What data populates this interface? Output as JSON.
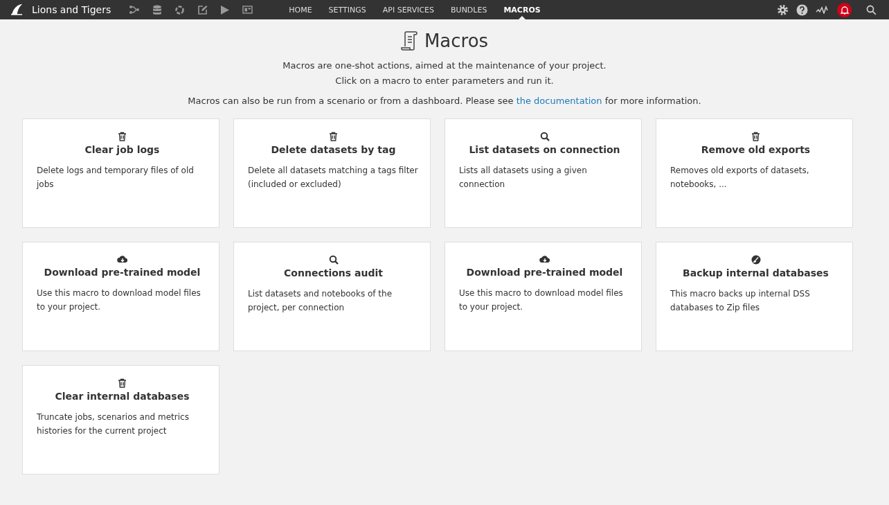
{
  "app": {
    "title": "Lions and Tigers"
  },
  "nav": [
    {
      "label": "HOME",
      "selected": false
    },
    {
      "label": "SETTINGS",
      "selected": false
    },
    {
      "label": "API SERVICES",
      "selected": false
    },
    {
      "label": "BUNDLES",
      "selected": false
    },
    {
      "label": "MACROS",
      "selected": true
    }
  ],
  "page": {
    "title": "Macros",
    "intro": [
      "Macros are one-shot actions, aimed at the maintenance of your project.",
      "Click on a macro to enter parameters and run it."
    ],
    "note_before": "Macros can also be run from a scenario or from a dashboard. Please see",
    "note_link": "the documentation",
    "note_after": "for more information."
  },
  "macros": [
    {
      "kind": "trash",
      "title": "Clear job logs",
      "description": "Delete logs and temporary files of old jobs"
    },
    {
      "kind": "trash",
      "title": "Delete datasets by tag",
      "description": "Delete all datasets matching a tags filter (included or excluded)"
    },
    {
      "kind": "search",
      "title": "List datasets on connection",
      "description": "Lists all datasets using a given connection"
    },
    {
      "kind": "trash",
      "title": "Remove old exports",
      "description": "Removes old exports of datasets, notebooks, ..."
    },
    {
      "kind": "download",
      "title": "Download pre-trained model",
      "description": "Use this macro to download model files to your project."
    },
    {
      "kind": "search",
      "title": "Connections audit",
      "description": "List datasets and notebooks of the project, per connection"
    },
    {
      "kind": "download",
      "title": "Download pre-trained model",
      "description": "Use this macro to download model files to your project."
    },
    {
      "kind": "brush",
      "title": "Backup internal databases",
      "description": "This macro backs up internal DSS databases to Zip files"
    },
    {
      "kind": "trash",
      "title": "Clear internal databases",
      "description": "Truncate jobs, scenarios and metrics histories for the current project"
    }
  ]
}
